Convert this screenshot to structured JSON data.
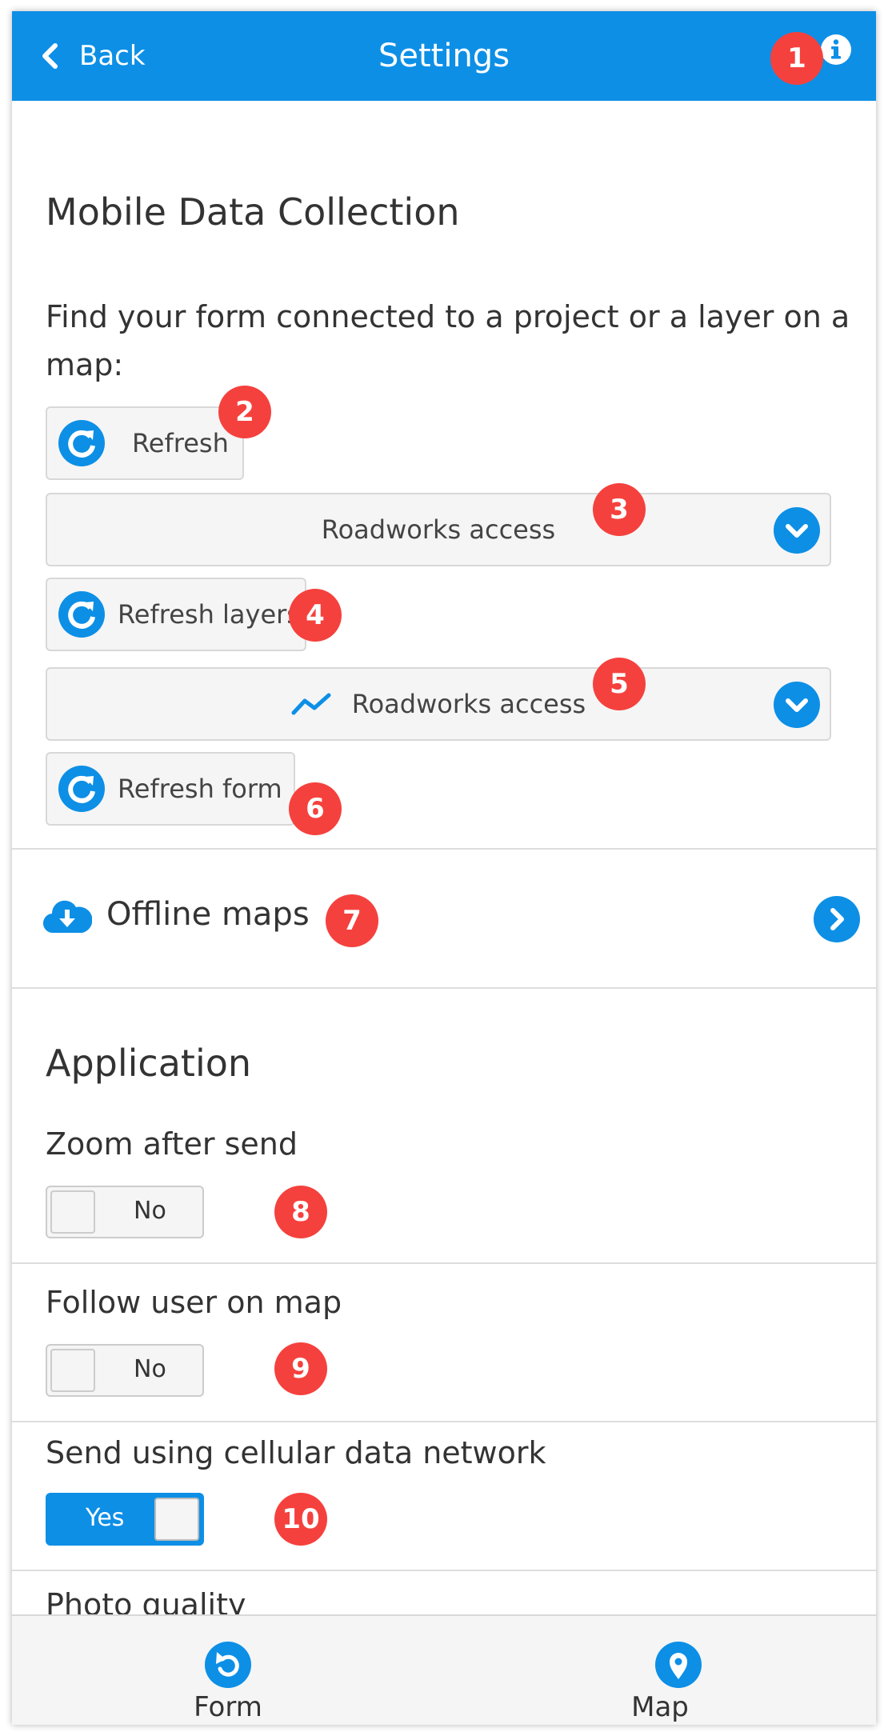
{
  "colors": {
    "accent": "#0d8fe6",
    "marker": "#f5413d",
    "toggle_on": "#0d8fe6"
  },
  "header": {
    "back_label": "Back",
    "title": "Settings",
    "info_icon": "info-icon"
  },
  "markers": [
    "1",
    "2",
    "3",
    "4",
    "5",
    "6",
    "7",
    "8",
    "9",
    "10"
  ],
  "mobile": {
    "title": "Mobile Data Collection",
    "intro": "Find your form connected to a project or a layer on a map:",
    "refresh_label": "Refresh",
    "project_select": "Roadworks access",
    "refresh_layers_label": "Refresh layers",
    "layer_select": "Roadworks access",
    "refresh_form_label": "Refresh form"
  },
  "offline": {
    "label": "Offline maps"
  },
  "application": {
    "title": "Application",
    "zoom_after_send": {
      "label": "Zoom after send",
      "state": "No"
    },
    "follow_user": {
      "label": "Follow user on map",
      "state": "No"
    },
    "cellular": {
      "label": "Send using cellular data network",
      "state": "Yes"
    },
    "photo_quality": {
      "label": "Photo quality"
    }
  },
  "footer": {
    "form_label": "Form",
    "map_label": "Map"
  }
}
